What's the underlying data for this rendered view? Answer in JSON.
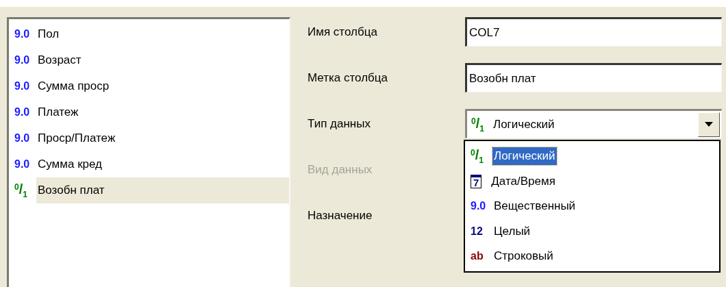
{
  "columns_list": {
    "items": [
      {
        "type_icon": "9.0",
        "kind": "real",
        "label": "Пол",
        "selected": false
      },
      {
        "type_icon": "9.0",
        "kind": "real",
        "label": "Возраст",
        "selected": false
      },
      {
        "type_icon": "9.0",
        "kind": "real",
        "label": "Сумма проср",
        "selected": false
      },
      {
        "type_icon": "9.0",
        "kind": "real",
        "label": "Платеж",
        "selected": false
      },
      {
        "type_icon": "9.0",
        "kind": "real",
        "label": "Проср/Платеж",
        "selected": false
      },
      {
        "type_icon": "9.0",
        "kind": "real",
        "label": "Сумма кред",
        "selected": false
      },
      {
        "type_icon": "$^{0}$/$_{1}$",
        "kind": "boolean",
        "label": "Возобн плат",
        "selected": true
      }
    ]
  },
  "properties": {
    "fields": [
      {
        "label": "Имя столбца",
        "kind": "text",
        "value": "COL7",
        "disabled": false
      },
      {
        "label": "Метка столбца",
        "kind": "text",
        "value": "Возобн плат",
        "disabled": false
      },
      {
        "label": "Тип данных",
        "kind": "combo",
        "icon": {
          "text": "$^{0}$/$_{1}$",
          "kind": "boolean"
        },
        "value": "Логический",
        "disabled": false
      },
      {
        "label": "Вид данных",
        "kind": "empty",
        "disabled": true
      },
      {
        "label": "Назначение",
        "kind": "empty",
        "disabled": false
      }
    ],
    "dropdown": {
      "options": [
        {
          "type_icon": "$^{0}$/$_{1}$",
          "kind": "boolean",
          "label": "Логический",
          "selected": true
        },
        {
          "type_icon": "7",
          "kind": "date",
          "label": "Дата/Время",
          "selected": false
        },
        {
          "type_icon": "9.0",
          "kind": "real",
          "label": "Вещественный",
          "selected": false
        },
        {
          "type_icon": "12",
          "kind": "integer",
          "label": "Целый",
          "selected": false
        },
        {
          "type_icon": "ab",
          "kind": "string",
          "label": "Строковый",
          "selected": false
        }
      ]
    }
  }
}
